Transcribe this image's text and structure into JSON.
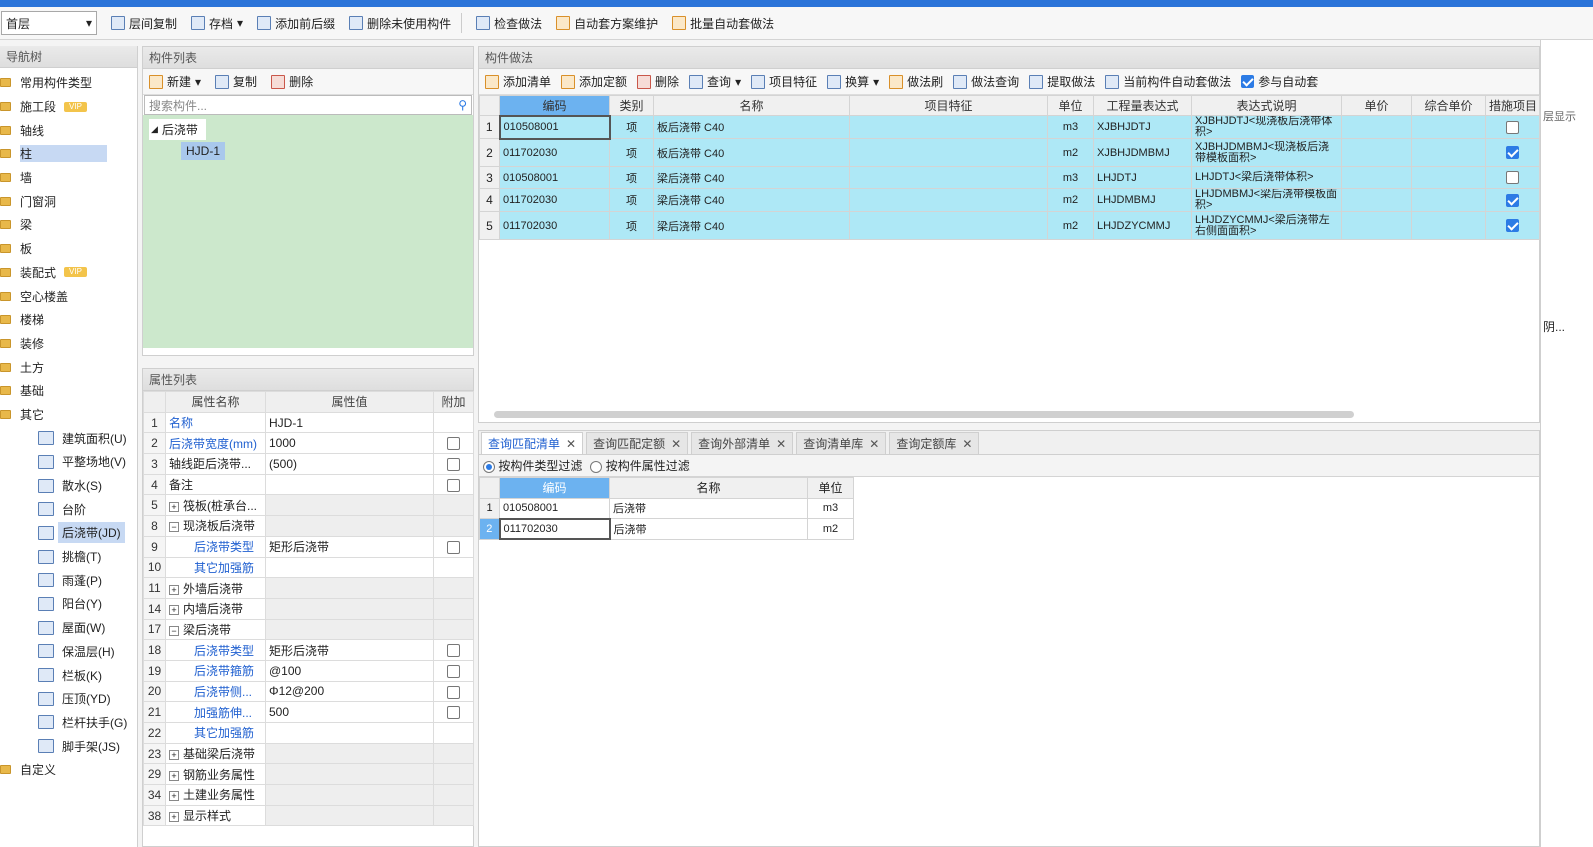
{
  "toolbar": {
    "floor": "首层",
    "buttons": [
      "层间复制",
      "存档",
      "添加前后缀",
      "删除未使用构件",
      "检查做法",
      "自动套方案维护",
      "批量自动套做法"
    ]
  },
  "nav": {
    "title": "导航树",
    "items": [
      {
        "label": "常用构件类型",
        "vip": ""
      },
      {
        "label": "施工段",
        "vip": "VIP"
      },
      {
        "label": "轴线",
        "vip": ""
      },
      {
        "label": "柱",
        "vip": ""
      },
      {
        "label": "墙",
        "vip": ""
      },
      {
        "label": "门窗洞",
        "vip": ""
      },
      {
        "label": "梁",
        "vip": ""
      },
      {
        "label": "板",
        "vip": ""
      },
      {
        "label": "装配式",
        "vip": "VIP"
      },
      {
        "label": "空心楼盖",
        "vip": ""
      },
      {
        "label": "楼梯",
        "vip": ""
      },
      {
        "label": "装修",
        "vip": ""
      },
      {
        "label": "土方",
        "vip": ""
      },
      {
        "label": "基础",
        "vip": ""
      },
      {
        "label": "其它",
        "vip": ""
      }
    ],
    "subitems": [
      "建筑面积(U)",
      "平整场地(V)",
      "散水(S)",
      "台阶",
      "后浇带(JD)",
      "挑檐(T)",
      "雨蓬(P)",
      "阳台(Y)",
      "屋面(W)",
      "保温层(H)",
      "栏板(K)",
      "压顶(YD)",
      "栏杆扶手(G)",
      "脚手架(JS)"
    ],
    "last": "自定义"
  },
  "complist": {
    "title": "构件列表",
    "new": "新建",
    "copy": "复制",
    "delete": "删除",
    "search_placeholder": "搜索构件...",
    "tree_root": "后浇带",
    "tree_child": "HJD-1"
  },
  "props": {
    "title": "属性列表",
    "headers": [
      "属性名称",
      "属性值",
      "附加"
    ],
    "rows": [
      {
        "n": "1",
        "name": "名称",
        "val": "HJD-1",
        "blue": true,
        "cb": "none",
        "group": false,
        "indent": false
      },
      {
        "n": "2",
        "name": "后浇带宽度(mm)",
        "val": "1000",
        "blue": true,
        "cb": "off",
        "group": false,
        "indent": false
      },
      {
        "n": "3",
        "name": "轴线距后浇带...",
        "val": "(500)",
        "blue": false,
        "cb": "off",
        "group": false,
        "indent": false
      },
      {
        "n": "4",
        "name": "备注",
        "val": "",
        "blue": false,
        "cb": "off",
        "group": false,
        "indent": false
      },
      {
        "n": "5",
        "name": "筏板(桩承台...",
        "val": "",
        "blue": false,
        "cb": "none",
        "group": "+",
        "indent": false
      },
      {
        "n": "8",
        "name": "现浇板后浇带",
        "val": "",
        "blue": false,
        "cb": "none",
        "group": "-",
        "indent": false
      },
      {
        "n": "9",
        "name": "后浇带类型",
        "val": "矩形后浇带",
        "blue": true,
        "cb": "off",
        "group": false,
        "indent": true
      },
      {
        "n": "10",
        "name": "其它加强筋",
        "val": "",
        "blue": true,
        "cb": "none",
        "group": false,
        "indent": true
      },
      {
        "n": "11",
        "name": "外墙后浇带",
        "val": "",
        "blue": false,
        "cb": "none",
        "group": "+",
        "indent": false
      },
      {
        "n": "14",
        "name": "内墙后浇带",
        "val": "",
        "blue": false,
        "cb": "none",
        "group": "+",
        "indent": false
      },
      {
        "n": "17",
        "name": "梁后浇带",
        "val": "",
        "blue": false,
        "cb": "none",
        "group": "-",
        "indent": false
      },
      {
        "n": "18",
        "name": "后浇带类型",
        "val": "矩形后浇带",
        "blue": true,
        "cb": "off",
        "group": false,
        "indent": true
      },
      {
        "n": "19",
        "name": "后浇带箍筋",
        "val": "@100",
        "blue": true,
        "cb": "off",
        "group": false,
        "indent": true
      },
      {
        "n": "20",
        "name": "后浇带侧...",
        "val": "Φ12@200",
        "blue": true,
        "cb": "off",
        "group": false,
        "indent": true
      },
      {
        "n": "21",
        "name": "加强筋伸...",
        "val": "500",
        "blue": true,
        "cb": "off",
        "group": false,
        "indent": true
      },
      {
        "n": "22",
        "name": "其它加强筋",
        "val": "",
        "blue": true,
        "cb": "none",
        "group": false,
        "indent": true
      },
      {
        "n": "23",
        "name": "基础梁后浇带",
        "val": "",
        "blue": false,
        "cb": "none",
        "group": "+",
        "indent": false
      },
      {
        "n": "29",
        "name": "钢筋业务属性",
        "val": "",
        "blue": false,
        "cb": "none",
        "group": "+",
        "indent": false
      },
      {
        "n": "34",
        "name": "土建业务属性",
        "val": "",
        "blue": false,
        "cb": "none",
        "group": "+",
        "indent": false
      },
      {
        "n": "38",
        "name": "显示样式",
        "val": "",
        "blue": false,
        "cb": "none",
        "group": "+",
        "indent": false
      }
    ]
  },
  "methods": {
    "title": "构件做法",
    "toolbar": [
      "添加清单",
      "添加定额",
      "删除",
      "查询",
      "项目特征",
      "换算",
      "做法刷",
      "做法查询",
      "提取做法",
      "当前构件自动套做法",
      "参与自动套"
    ],
    "headers": [
      "编码",
      "类别",
      "名称",
      "项目特征",
      "单位",
      "工程量表达式",
      "表达式说明",
      "单价",
      "综合单价",
      "措施项目"
    ],
    "rows": [
      {
        "n": "1",
        "code": "010508001",
        "type": "项",
        "name": "板后浇带 C40",
        "feature": "",
        "unit": "m3",
        "expr": "XJBHJDTJ",
        "desc": "XJBHJDTJ<现浇板后浇带体积>",
        "price": "",
        "total": "",
        "measure": false
      },
      {
        "n": "2",
        "code": "011702030",
        "type": "项",
        "name": "板后浇带 C40",
        "feature": "",
        "unit": "m2",
        "expr": "XJBHJDMBMJ",
        "desc": "XJBHJDMBMJ<现浇板后浇带模板面积>",
        "price": "",
        "total": "",
        "measure": true
      },
      {
        "n": "3",
        "code": "010508001",
        "type": "项",
        "name": "梁后浇带 C40",
        "feature": "",
        "unit": "m3",
        "expr": "LHJDTJ",
        "desc": "LHJDTJ<梁后浇带体积>",
        "price": "",
        "total": "",
        "measure": false
      },
      {
        "n": "4",
        "code": "011702030",
        "type": "项",
        "name": "梁后浇带 C40",
        "feature": "",
        "unit": "m2",
        "expr": "LHJDMBMJ",
        "desc": "LHJDMBMJ<梁后浇带模板面积>",
        "price": "",
        "total": "",
        "measure": true
      },
      {
        "n": "5",
        "code": "011702030",
        "type": "项",
        "name": "梁后浇带 C40",
        "feature": "",
        "unit": "m2",
        "expr": "LHJDZYCMMJ",
        "desc": "LHJDZYCMMJ<梁后浇带左右侧面面积>",
        "price": "",
        "total": "",
        "measure": true
      }
    ]
  },
  "query": {
    "tabs": [
      "查询匹配清单",
      "查询匹配定额",
      "查询外部清单",
      "查询清单库",
      "查询定额库"
    ],
    "filter1": "按构件类型过滤",
    "filter2": "按构件属性过滤",
    "headers": [
      "编码",
      "名称",
      "单位"
    ],
    "rows": [
      {
        "n": "1",
        "code": "010508001",
        "name": "后浇带",
        "unit": "m3"
      },
      {
        "n": "2",
        "code": "011702030",
        "name": "后浇带",
        "unit": "m2"
      }
    ]
  },
  "rightedge": {
    "label1": "层显示",
    "label2": "阴..."
  }
}
